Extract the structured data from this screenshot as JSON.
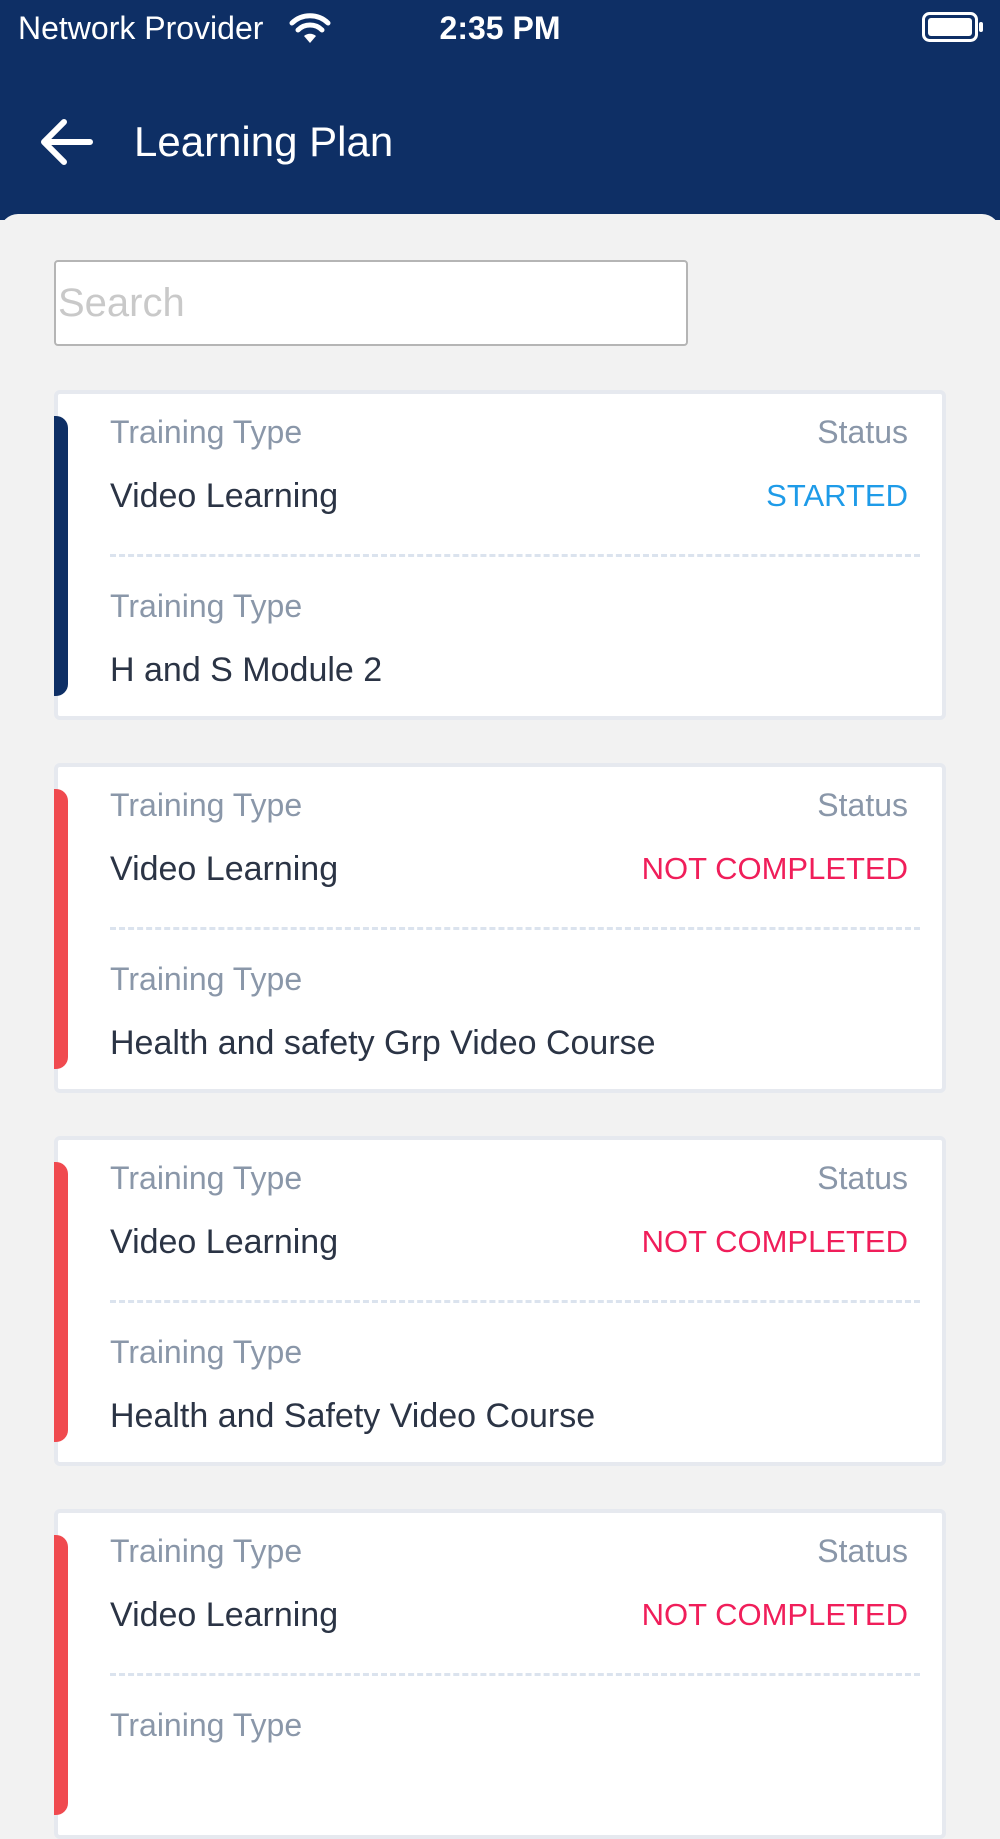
{
  "status_bar": {
    "provider": "Network Provider",
    "time": "2:35 PM"
  },
  "header": {
    "title": "Learning Plan"
  },
  "search": {
    "placeholder": "Search",
    "value": ""
  },
  "colors": {
    "primary": "#0e2f65",
    "started": "#1e9be8",
    "not_completed": "#f01e5a",
    "accent_red": "#f04a4f"
  },
  "cards": [
    {
      "type_label": "Training Type",
      "type_value": "Video Learning",
      "status_label": "Status",
      "status_value": "STARTED",
      "name_label": "Training Type",
      "name_value": "H and S Module 2"
    },
    {
      "type_label": "Training Type",
      "type_value": "Video Learning",
      "status_label": "Status",
      "status_value": "NOT COMPLETED",
      "name_label": "Training Type",
      "name_value": "Health and safety Grp Video Course"
    },
    {
      "type_label": "Training Type",
      "type_value": "Video Learning",
      "status_label": "Status",
      "status_value": "NOT COMPLETED",
      "name_label": "Training Type",
      "name_value": "Health and Safety Video Course"
    },
    {
      "type_label": "Training Type",
      "type_value": "Video Learning",
      "status_label": "Status",
      "status_value": "NOT COMPLETED",
      "name_label": "Training Type",
      "name_value": ""
    }
  ]
}
